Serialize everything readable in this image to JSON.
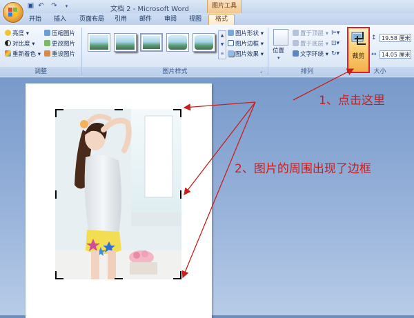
{
  "window": {
    "title": "文档 2 - Microsoft Word",
    "context_tab_group": "图片工具"
  },
  "tabs": [
    "开始",
    "插入",
    "页面布局",
    "引用",
    "邮件",
    "审阅",
    "视图",
    "格式"
  ],
  "ribbon": {
    "adjust": {
      "label": "调整",
      "brightness": "亮度",
      "contrast": "对比度",
      "recolor": "重新着色",
      "compress": "压缩图片",
      "change": "更改图片",
      "reset": "重设图片"
    },
    "styles": {
      "label": "图片样式",
      "shape": "图片形状",
      "border": "图片边框",
      "effects": "图片效果"
    },
    "arrange": {
      "label": "排列",
      "position": "位置",
      "bring_front": "置于顶层",
      "send_back": "置于底层",
      "text_wrap": "文字环绕"
    },
    "size": {
      "label": "大小",
      "crop": "裁剪",
      "height": "19.58 厘米",
      "width": "14.05 厘米"
    }
  },
  "annotations": {
    "step1": "1、点击这里",
    "step2": "2、图片的周围出现了边框"
  },
  "colors": {
    "annotation": "#c81e1e",
    "crop_highlight": "#e02020",
    "context_tab": "#f0c890"
  }
}
